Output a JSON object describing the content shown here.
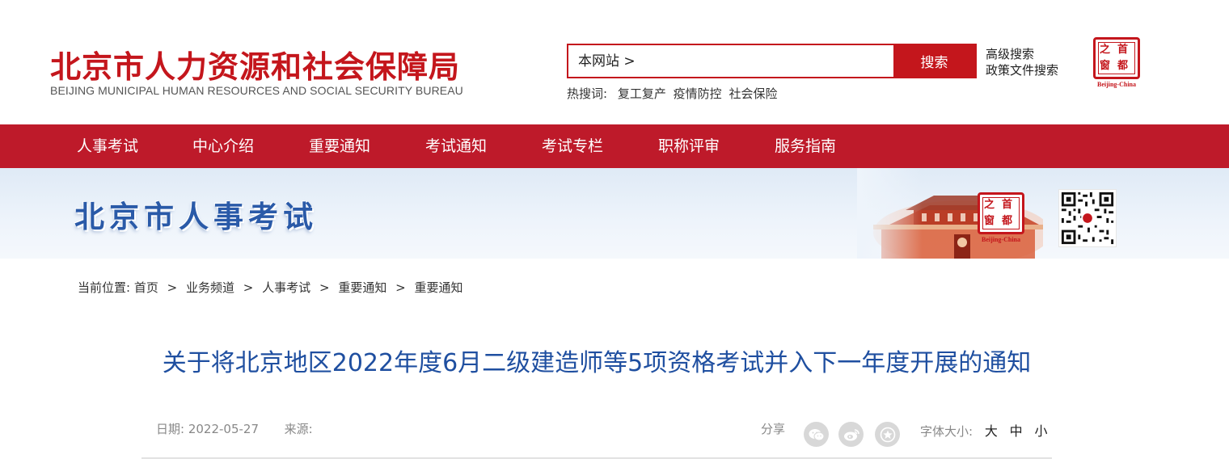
{
  "header": {
    "logo_cn": "北京市人力资源和社会保障局",
    "logo_en": "BEIJING MUNICIPAL HUMAN RESOURCES AND SOCIAL SECURITY BUREAU",
    "search_placeholder": "本网站 >",
    "search_button": "搜索",
    "advanced_search": "高级搜索",
    "policy_search": "政策文件搜索",
    "hot_label": "热搜词:",
    "hot_terms": [
      "复工复产",
      "疫情防控",
      "社会保险"
    ],
    "stamp": {
      "chars": [
        "之",
        "首",
        "窗",
        "都"
      ],
      "caption": "Beijing-China"
    }
  },
  "nav": {
    "items": [
      "人事考试",
      "中心介绍",
      "重要通知",
      "考试通知",
      "考试专栏",
      "职称评审",
      "服务指南"
    ]
  },
  "banner": {
    "title": "北京市人事考试"
  },
  "breadcrumb": {
    "label": "当前位置:",
    "items": [
      "首页",
      "业务频道",
      "人事考试",
      "重要通知",
      "重要通知"
    ],
    "separator": ">"
  },
  "article": {
    "title": "关于将北京地区2022年度6月二级建造师等5项资格考试并入下一年度开展的通知",
    "date_label": "日期:",
    "date": "2022-05-27",
    "source_label": "来源:",
    "share_label": "分享",
    "share_icons": [
      "wechat-icon",
      "weibo-icon",
      "favorite-icon"
    ],
    "fontsize_label": "字体大小:",
    "fontsize_options": [
      "大",
      "中",
      "小"
    ]
  },
  "colors": {
    "brand_red": "#be1a2a",
    "title_blue": "#1f4fa0",
    "banner_blue": "#2a5aa8"
  }
}
